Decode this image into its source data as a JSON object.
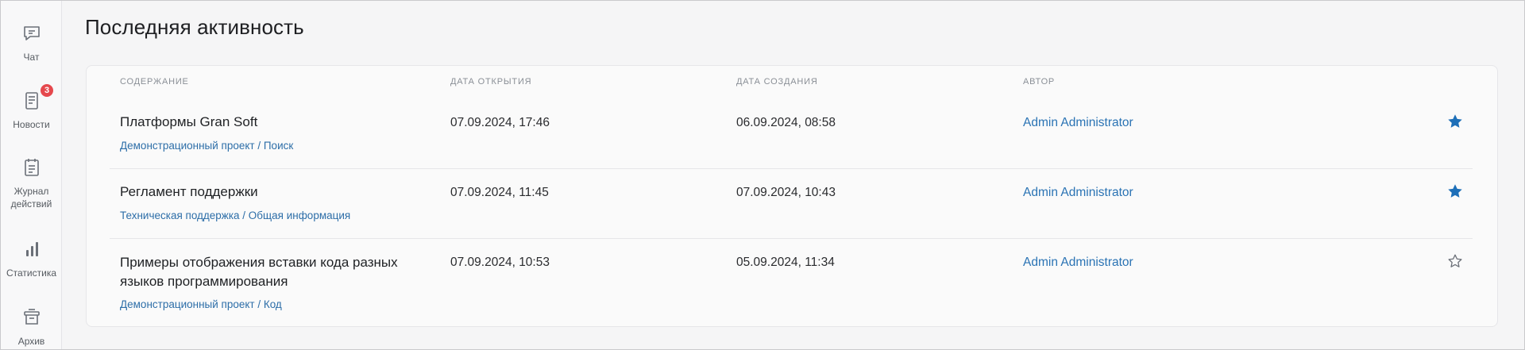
{
  "sidebar": {
    "items": [
      {
        "label": "Чат",
        "icon": "chat-icon"
      },
      {
        "label": "Новости",
        "icon": "news-icon",
        "badge": "3"
      },
      {
        "label": "Журнал действий",
        "icon": "journal-icon"
      },
      {
        "label": "Статистика",
        "icon": "statistics-icon"
      },
      {
        "label": "Архив",
        "icon": "archive-icon"
      }
    ]
  },
  "page": {
    "title": "Последняя активность"
  },
  "table": {
    "columns": {
      "content": "СОДЕРЖАНИЕ",
      "opened": "ДАТА ОТКРЫТИЯ",
      "created": "ДАТА СОЗДАНИЯ",
      "author": "АВТОР"
    },
    "rows": [
      {
        "title": "Платформы Gran Soft",
        "path": "Демонстрационный проект / Поиск",
        "opened": "07.09.2024, 17:46",
        "created": "06.09.2024, 08:58",
        "author": "Admin Administrator",
        "favorite": true
      },
      {
        "title": "Регламент поддержки",
        "path": "Техническая поддержка / Общая информация",
        "opened": "07.09.2024, 11:45",
        "created": "07.09.2024, 10:43",
        "author": "Admin Administrator",
        "favorite": true
      },
      {
        "title": "Примеры отображения вставки кода разных языков программирования",
        "path": "Демонстрационный проект / Код",
        "opened": "07.09.2024, 10:53",
        "created": "05.09.2024, 11:34",
        "author": "Admin Administrator",
        "favorite": false
      }
    ]
  },
  "colors": {
    "accent": "#1d6fb8",
    "link": "#2a73b4",
    "badge": "#e5484d"
  }
}
